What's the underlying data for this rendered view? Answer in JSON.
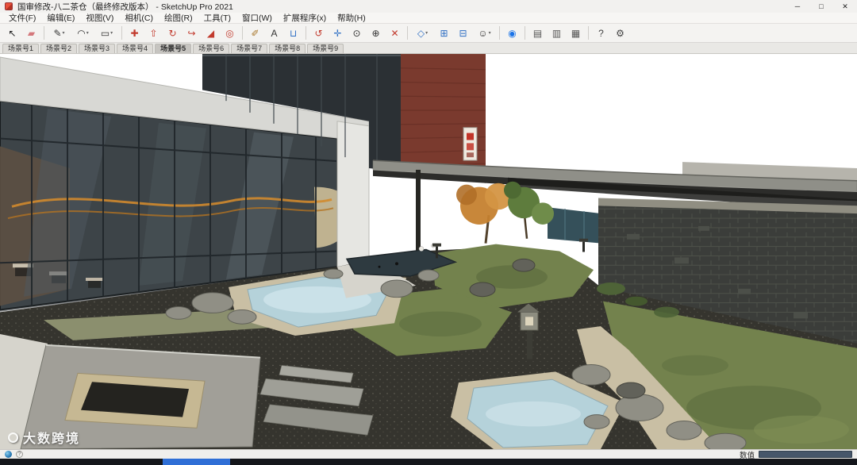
{
  "window": {
    "title": "国审修改-八二茶仓（最终修改版本） - SketchUp Pro 2021",
    "minimize_glyph": "─",
    "maximize_glyph": "□",
    "close_glyph": "✕"
  },
  "menu": {
    "items": [
      "文件(F)",
      "编辑(E)",
      "视图(V)",
      "相机(C)",
      "绘图(R)",
      "工具(T)",
      "窗口(W)",
      "扩展程序(x)",
      "帮助(H)"
    ]
  },
  "toolbar": {
    "tools": [
      {
        "name": "select-tool",
        "glyph": "↖",
        "color": "#1b1b1b"
      },
      {
        "name": "eraser-tool",
        "glyph": "▰",
        "color": "#d4787c"
      },
      {
        "sep": true
      },
      {
        "name": "line-tool",
        "glyph": "✎",
        "color": "#333333",
        "dropdown": true
      },
      {
        "name": "arc-tool",
        "glyph": "◠",
        "color": "#333333",
        "dropdown": true
      },
      {
        "name": "rectangle-tool",
        "glyph": "▭",
        "color": "#333333",
        "dropdown": true
      },
      {
        "sep": true
      },
      {
        "name": "move-tool",
        "glyph": "✚",
        "color": "#c23b2e"
      },
      {
        "name": "push-pull-tool",
        "glyph": "⇧",
        "color": "#c23b2e"
      },
      {
        "name": "rotate-tool",
        "glyph": "↻",
        "color": "#c23b2e"
      },
      {
        "name": "follow-me-tool",
        "glyph": "↪",
        "color": "#c23b2e"
      },
      {
        "name": "scale-tool",
        "glyph": "◢",
        "color": "#c23b2e"
      },
      {
        "name": "offset-tool",
        "glyph": "◎",
        "color": "#c23b2e"
      },
      {
        "sep": true
      },
      {
        "name": "tape-measure-tool",
        "glyph": "✐",
        "color": "#a8762a"
      },
      {
        "name": "text-tool",
        "glyph": "A",
        "color": "#333333"
      },
      {
        "name": "paint-bucket-tool",
        "glyph": "⊔",
        "color": "#2e6fc4"
      },
      {
        "sep": true
      },
      {
        "name": "orbit-tool",
        "glyph": "↺",
        "color": "#c23b2e"
      },
      {
        "name": "pan-tool",
        "glyph": "✛",
        "color": "#2e6fc4"
      },
      {
        "name": "zoom-tool",
        "glyph": "⊙",
        "color": "#333333"
      },
      {
        "name": "zoom-extents-tool",
        "glyph": "⊕",
        "color": "#333333"
      },
      {
        "name": "delete-guides-tool",
        "glyph": "✕",
        "color": "#c23b2e"
      },
      {
        "sep": true
      },
      {
        "name": "view-iso-tool",
        "glyph": "◇",
        "color": "#2e6fc4",
        "dropdown": true
      },
      {
        "name": "view-top-tool",
        "glyph": "⊞",
        "color": "#2e6fc4"
      },
      {
        "name": "view-front-tool",
        "glyph": "⊟",
        "color": "#2e6fc4"
      },
      {
        "name": "walk-tool",
        "glyph": "☺",
        "color": "#333333",
        "dropdown": true
      },
      {
        "sep": true
      },
      {
        "name": "extension-tool",
        "glyph": "◉",
        "color": "#1a73e8"
      },
      {
        "sep": true
      },
      {
        "name": "section-plane-toggle",
        "glyph": "▤",
        "color": "#555555"
      },
      {
        "name": "section-fill-toggle",
        "glyph": "▥",
        "color": "#555555"
      },
      {
        "name": "section-cut-toggle",
        "glyph": "▦",
        "color": "#555555"
      },
      {
        "sep": true
      },
      {
        "name": "help-button",
        "glyph": "?",
        "color": "#444444"
      },
      {
        "name": "preferences-button",
        "glyph": "⚙",
        "color": "#444444"
      }
    ]
  },
  "scene_tabs": {
    "tabs": [
      {
        "label": "场景号1"
      },
      {
        "label": "场景号2"
      },
      {
        "label": "场景号3"
      },
      {
        "label": "场景号4"
      },
      {
        "label": "场景号5",
        "active": true
      },
      {
        "label": "场景号6"
      },
      {
        "label": "场景号7"
      },
      {
        "label": "场景号8"
      },
      {
        "label": "场景号9"
      }
    ]
  },
  "viewport": {
    "description": "3D garden courtyard model: glass tea-house facade left, brick building and tiled canopy top, stacked stone wall right, moss garden with ponds, rocks, stone platform and lanterns",
    "palette": {
      "sky": "#ffffff",
      "fascia": "#d8d8d4",
      "column": "#e6e6e2",
      "glass": "#3d4448",
      "dark_building": "#2b3034",
      "brick": "#7a3a2e",
      "light_wall": "#b6b4ac",
      "roof_tile": "#8f8f88",
      "roof_eave": "#2c2c2a",
      "stone_wall": "#3b3d3a",
      "stone_cap": "#908e82",
      "gravel": "#35342e",
      "moss": "#73824d",
      "path": "#c9bfa4",
      "water": "#b5d2da",
      "pavement": "#d6d4cc",
      "platform": "#a19f98",
      "platform_inner": "#c6b893",
      "firepit": "#24231f",
      "rock": "#908f85",
      "accent_blue": "#2f6fd6"
    }
  },
  "watermark": {
    "text": "大数跨境"
  },
  "statusbar": {
    "help_glyph": "?",
    "value_label": "数值",
    "value_text": ""
  }
}
